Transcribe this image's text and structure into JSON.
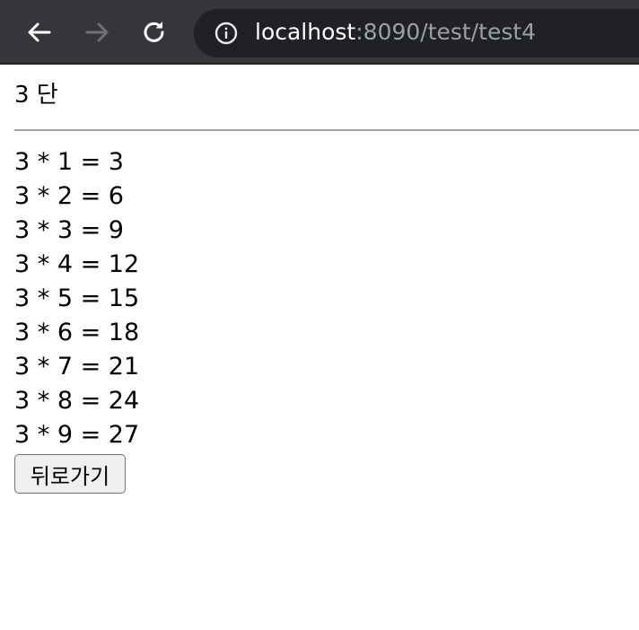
{
  "browser": {
    "url_host": "localhost",
    "url_rest": ":8090/test/test4",
    "icons": [
      "back-arrow-icon",
      "forward-arrow-icon",
      "reload-icon",
      "info-icon"
    ]
  },
  "page": {
    "heading": "3 단",
    "lines": [
      "3 * 1 = 3",
      "3 * 2 = 6",
      "3 * 3 = 9",
      "3 * 4 = 12",
      "3 * 5 = 15",
      "3 * 6 = 18",
      "3 * 7 = 21",
      "3 * 8 = 24",
      "3 * 9 = 27"
    ],
    "back_button_label": "뒤로가기"
  },
  "colors": {
    "toolbar_bg": "#35363a",
    "omnibox_bg": "#202124",
    "url_host": "#ffffff",
    "url_rest": "#9aa0a6",
    "forward_disabled": "#6f7175"
  }
}
